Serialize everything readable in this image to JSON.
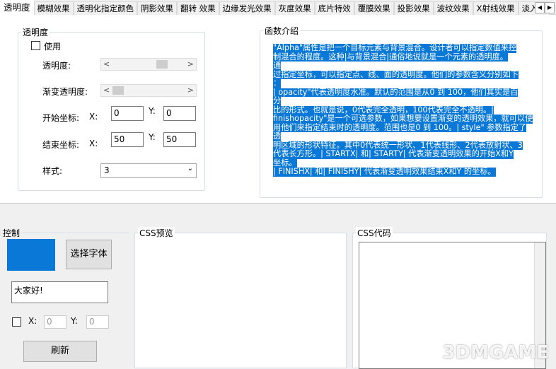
{
  "tabs": [
    "透明度",
    "模糊效果",
    "透明化指定颜色",
    "阴影效果",
    "翻转 效果",
    "边缘发光效果",
    "灰度效果",
    "底片特效",
    "覆膜效果",
    "投影效果",
    "波纹效果",
    "X射线效果",
    "淡入淡"
  ],
  "tab_scroll": {
    "left": "◀",
    "right": "▶"
  },
  "alpha_group": {
    "title": "透明度",
    "use_label": "使用",
    "opacity_label": "透明度:",
    "gradient_label": "渐变透明度:",
    "start_label": "开始坐标:",
    "end_label": "结束坐标:",
    "x_label": "X:",
    "y_label": "Y:",
    "start_x": "0",
    "start_y": "0",
    "end_x": "50",
    "end_y": "50",
    "style_label": "样式:",
    "style_value": "3",
    "opacity_slider": 0.6,
    "gradient_slider": 0.1
  },
  "intro": {
    "title": "函数介绍",
    "lines": [
      "   \"Alpha\"属性是把一个目标元素与背景混合。设计者可以指定数值来控",
      "制混合的程度。这种|与背景混合|通俗地说就是一个元素的透明度。",
      "通",
      "过指定坐标，可以指定点、线、面的透明度。他们的参数含义分别如下",
      "：",
      "   | opacity\"代表透明度水准。默认的范围是从0 到 100，他们其实是百",
      "分",
      "比的形式。也就是说，0代表完全透明，100代表完全不透明。|",
      "finishopacity\"是一个可选参数，如果想要设置渐变的透明效果，就可以使",
      "用他们来指定结束时的透明度。范围也是0 到 100。| style\" 参数指定了",
      "透",
      "明区域的形状特征。其中0代表统一形状、1代表线形、2代表放射状、3",
      "代表长方形。| STARTX| 和| STARTY| 代表渐变透明效果的开始X和Y",
      "坐标。",
      "| FINISHX| 和| FINISHY| 代表渐变透明效果结束X和Y 的坐标。"
    ]
  },
  "control": {
    "title": "控制",
    "color": "#0a78d7",
    "font_button": "选择字体",
    "text_value": "大家好!",
    "x_label": "X:",
    "y_label": "Y:",
    "x_value": "0",
    "y_value": "0",
    "refresh_button": "刷新"
  },
  "preview": {
    "title": "CSS预览"
  },
  "code": {
    "title": "CSS代码"
  },
  "watermark": "3DMGAME"
}
